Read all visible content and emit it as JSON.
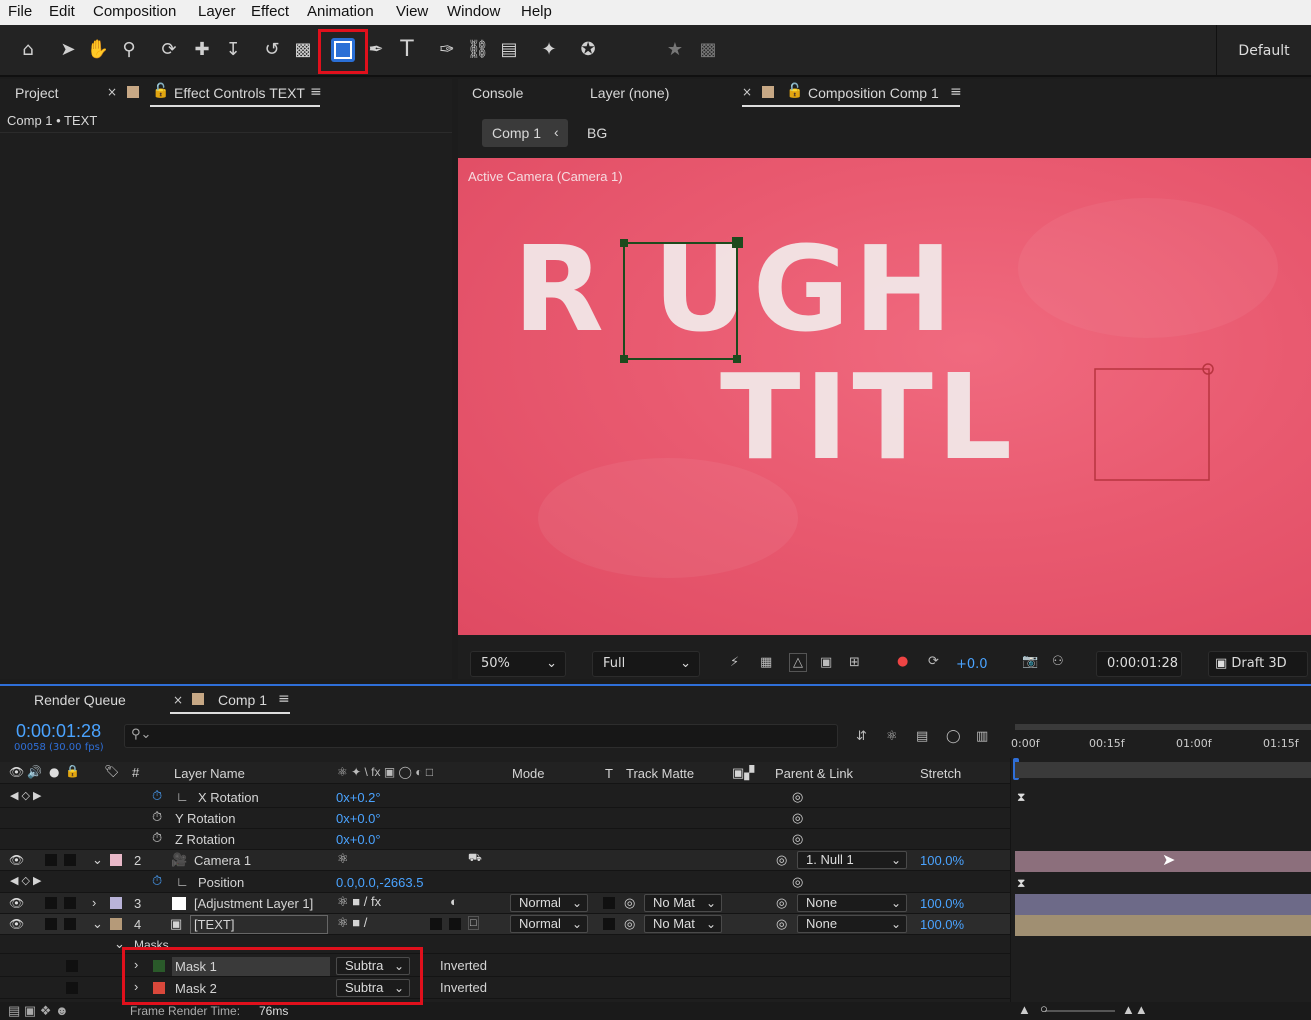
{
  "menu": [
    "File",
    "Edit",
    "Composition",
    "Layer",
    "Effect",
    "Animation",
    "View",
    "Window",
    "Help"
  ],
  "toolbar": {
    "workspace": "Default",
    "tools": [
      "home-icon",
      "selection-icon",
      "hand-icon",
      "zoom-icon",
      "orbit-camera-icon",
      "pan-camera-icon",
      "dolly-camera-icon",
      "rotate-icon",
      "anchor-point-icon",
      "rectangle-tool-icon",
      "pen-tool-icon",
      "type-tool-icon",
      "brush-tool-icon",
      "clone-stamp-icon",
      "eraser-icon",
      "roto-brush-icon",
      "puppet-pin-icon",
      "star-icon",
      "snapping-icon"
    ],
    "selected_tool": "rectangle-tool-icon"
  },
  "left_panel": {
    "tab_project": "Project",
    "tab_effect_controls": "Effect Controls TEXT",
    "subtitle": "Comp 1 • TEXT"
  },
  "right_panel": {
    "tab_console": "Console",
    "tab_layer": "Layer (none)",
    "tab_composition": "Composition Comp 1",
    "flow_comp": "Comp 1",
    "flow_bg": "BG",
    "active_camera": "Active Camera (Camera 1)",
    "title_line1": "R UGH",
    "title_line2": "TITL",
    "zoom": "50%",
    "resolution": "Full",
    "exposure": "+0.0",
    "timecode": "0:00:01:28",
    "renderer": "Draft 3D"
  },
  "timeline": {
    "tab_render_queue": "Render Queue",
    "tab_comp": "Comp 1",
    "current_time": "0:00:01:28",
    "frame_info": "00058 (30.00 fps)",
    "search_placeholder": "",
    "ruler": [
      "0:00f",
      "00:15f",
      "01:00f",
      "01:15f"
    ],
    "headers": {
      "hash": "#",
      "layer_name": "Layer Name",
      "mode": "Mode",
      "t": "T",
      "track_matte": "Track Matte",
      "parent": "Parent & Link",
      "stretch": "Stretch"
    },
    "rows": [
      {
        "prop": "X Rotation",
        "value": "0x+0.2°"
      },
      {
        "prop": "Y Rotation",
        "value": "0x+0.0°"
      },
      {
        "prop": "Z Rotation",
        "value": "0x+0.0°"
      }
    ],
    "layer2": {
      "num": "2",
      "name": "Camera 1",
      "parent": "1. Null 1",
      "stretch": "100.0%",
      "color": "#e8b8c8"
    },
    "position": {
      "prop": "Position",
      "value": "0.0,0.0,-2663.5"
    },
    "layer3": {
      "num": "3",
      "name": "[Adjustment Layer 1]",
      "mode": "Normal",
      "matte": "No Mat",
      "parent": "None",
      "stretch": "100.0%",
      "color": "#b9b3d9"
    },
    "layer4": {
      "num": "4",
      "name": "[TEXT]",
      "mode": "Normal",
      "matte": "No Mat",
      "parent": "None",
      "stretch": "100.0%",
      "color": "#b59a79"
    },
    "masks_label": "Masks",
    "masks": [
      {
        "name": "Mask 1",
        "mode": "Subtra",
        "inverted": "Inverted",
        "color": "#2a5a2a"
      },
      {
        "name": "Mask 2",
        "mode": "Subtra",
        "inverted": "Inverted",
        "color": "#d9483b"
      }
    ],
    "frame_render_label": "Frame Render Time:",
    "frame_render_value": "76ms"
  },
  "colors": {
    "viewer_bg": "#e95a70",
    "accent_blue": "#4aa3ff",
    "highlight_red": "#e0101c"
  }
}
